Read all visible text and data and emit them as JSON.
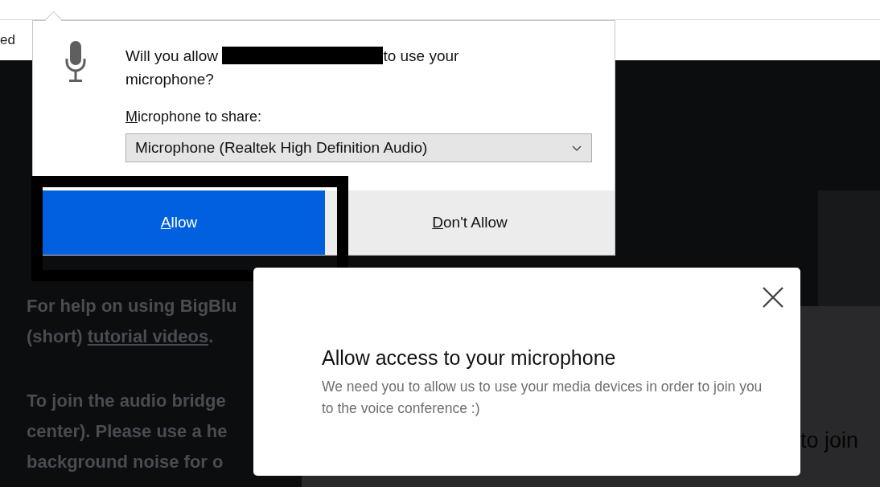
{
  "browser": {
    "toolbar_text": "ed"
  },
  "page": {
    "left_lines": [
      {
        "text": "For help on using BigBlu"
      },
      {
        "text": "(short) ",
        "link_text": "tutorial videos",
        "after": "."
      },
      {
        "text": "To join the audio bridge"
      },
      {
        "text": "center). Please use a he"
      },
      {
        "text": "background noise for o"
      }
    ],
    "right_text": "to join"
  },
  "permission_popup": {
    "question_before": "Will you allow",
    "question_redacted": true,
    "question_after": "to use your microphone?",
    "device_label": "Microphone to share:",
    "device_label_access_key_underlined": true,
    "device_value": "Microphone (Realtek High Definition Audio)",
    "buttons": [
      {
        "label": "Allow",
        "kind": "primary",
        "access_key_underlined": true
      },
      {
        "label": "Don't Allow",
        "kind": "secondary",
        "access_key_underlined": true
      }
    ],
    "highlight_frame": true
  },
  "modal": {
    "title": "Allow access to your microphone",
    "body": "We need you to allow us to use your media devices in order to join you to the voice conference :)"
  }
}
